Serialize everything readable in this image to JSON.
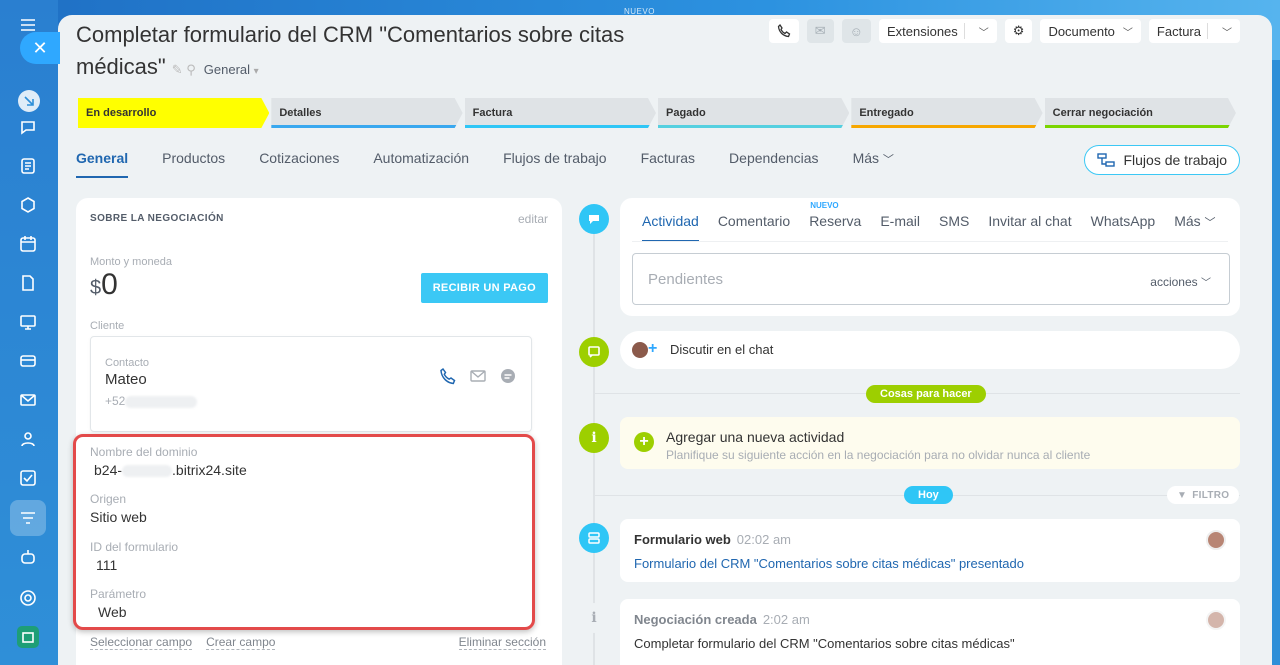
{
  "top_badge": "NUEVO",
  "deal": {
    "title": "Completar formulario del CRM \"Comentarios sobre citas médicas\"",
    "category": "General"
  },
  "toolbar": {
    "extensions": "Extensiones",
    "document": "Documento",
    "invoice": "Factura"
  },
  "stages": [
    {
      "label": "En desarrollo",
      "color": "#ffff00",
      "active": true
    },
    {
      "label": "Detalles",
      "color": "#39a8ef"
    },
    {
      "label": "Factura",
      "color": "#2fc6f6"
    },
    {
      "label": "Pagado",
      "color": "#55d0e0"
    },
    {
      "label": "Entregado",
      "color": "#f7a700"
    },
    {
      "label": "Cerrar negociación",
      "color": "#7bd500"
    }
  ],
  "tabs": [
    "General",
    "Productos",
    "Cotizaciones",
    "Automatización",
    "Flujos de trabajo",
    "Facturas",
    "Dependencias",
    "Más"
  ],
  "workflow_button": "Flujos de trabajo",
  "about": {
    "heading": "SOBRE LA NEGOCIACIÓN",
    "edit": "editar",
    "amount_label": "Monto y moneda",
    "currency": "$",
    "amount": "0",
    "pay_button": "RECIBIR UN PAGO",
    "client_label": "Cliente",
    "contact_label": "Contacto",
    "contact_name": "Mateo",
    "contact_phone": "+52",
    "domain_label": "Nombre del dominio",
    "domain_prefix": "b24-",
    "domain_suffix": ".bitrix24.site",
    "origin_label": "Origen",
    "origin_value": "Sitio web",
    "form_id_label": "ID del formulario",
    "form_id_value": "111",
    "param_label": "Parámetro",
    "param_value": "Web",
    "select_field": "Seleccionar campo",
    "create_field": "Crear campo",
    "delete_section": "Eliminar sección"
  },
  "activity": {
    "tabs": [
      "Actividad",
      "Comentario",
      "Reserva",
      "E-mail",
      "SMS",
      "Invitar al chat",
      "WhatsApp",
      "Más"
    ],
    "new_badge": "NUEVO",
    "pending_placeholder": "Pendientes",
    "actions": "acciones"
  },
  "chat": {
    "label": "Discutir en el chat"
  },
  "todo_pill": "Cosas para hacer",
  "todo": {
    "title": "Agregar una nueva actividad",
    "hint": "Planifique su siguiente acción en la negociación para no olvidar nunca al cliente"
  },
  "today_pill": "Hoy",
  "filter": "FILTRO",
  "events": [
    {
      "title": "Formulario web",
      "time": "02:02 am",
      "body": "Formulario del CRM \"Comentarios sobre citas médicas\" presentado"
    },
    {
      "title": "Negociación creada",
      "time": "2:02 am",
      "body": "Completar formulario del CRM \"Comentarios sobre citas médicas\""
    }
  ],
  "colors": {
    "accent": "#2fc6f6",
    "link": "#2067b0",
    "highlight": "#e34a4a",
    "todo_green": "#9dcf00"
  }
}
